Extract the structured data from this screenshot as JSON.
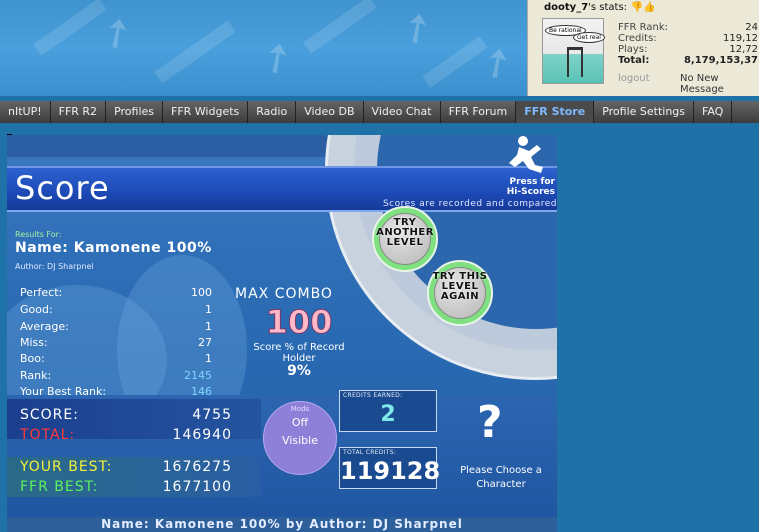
{
  "user_stats": {
    "username": "dooty_7",
    "suffix": "'s stats:",
    "speech_bubble_1": "Be rational",
    "speech_bubble_2": "Get real",
    "rows": [
      {
        "label": "FFR Rank:",
        "value": "24"
      },
      {
        "label": "Credits:",
        "value": "119,12"
      },
      {
        "label": "Plays:",
        "value": "12,72"
      },
      {
        "label": "Total:",
        "value": "8,179,153,37"
      }
    ],
    "logout": "logout",
    "messages": "No New Message"
  },
  "nav": {
    "tabs": [
      {
        "label": "nItUP!",
        "active": false
      },
      {
        "label": "FFR R2",
        "active": false
      },
      {
        "label": "Profiles",
        "active": false
      },
      {
        "label": "FFR Widgets",
        "active": false
      },
      {
        "label": "Radio",
        "active": false
      },
      {
        "label": "Video DB",
        "active": false
      },
      {
        "label": "Video Chat",
        "active": false
      },
      {
        "label": "FFR Forum",
        "active": false
      },
      {
        "label": "FFR Store",
        "active": true
      },
      {
        "label": "Profile Settings",
        "active": false
      },
      {
        "label": "FAQ",
        "active": false
      }
    ]
  },
  "game": {
    "title": "Score",
    "press_for": "Press for",
    "hi_scores": "Hi-Scores",
    "recorded_note": "Scores are recorded and compared",
    "try_another": [
      "TRY",
      "ANOTHER",
      "LEVEL"
    ],
    "try_again": [
      "TRY THIS",
      "LEVEL",
      "AGAIN"
    ],
    "results_for": "Results For:",
    "song_name": "Name: Kamonene 100%",
    "song_author": "Author: DJ Sharpnel",
    "stats": [
      {
        "label": "Perfect:",
        "value": "100"
      },
      {
        "label": "Good:",
        "value": "1"
      },
      {
        "label": "Average:",
        "value": "1"
      },
      {
        "label": "Miss:",
        "value": "27"
      },
      {
        "label": "Boo:",
        "value": "1"
      },
      {
        "label": "Rank:",
        "value": "2145"
      },
      {
        "label": "Your Best Rank:",
        "value": "146"
      }
    ],
    "max_combo_label": "MAX COMBO",
    "max_combo_value": "100",
    "pct_label": "Score % of Record Holder",
    "pct_value": "9%",
    "score_label": "SCORE:",
    "score_value": "4755",
    "total_label": "TOTAL:",
    "total_value": "146940",
    "your_best_label": "YOUR BEST:",
    "your_best_value": "1676275",
    "ffr_best_label": "FFR BEST:",
    "ffr_best_value": "1677100",
    "mods_label": "Mods",
    "mods_off": "Off",
    "mods_visible": "Visible",
    "credits_earned_label": "CREDITS EARNED:",
    "credits_earned_value": "2",
    "total_credits_label": "TOTAL CREDITS:",
    "total_credits_value": "119128",
    "question_mark": "?",
    "choose_character": "Please Choose a Character",
    "footer": "Name: Kamonene 100% by Author: DJ Sharpnel"
  },
  "colors": {
    "page_bg": "#1e72a8",
    "nav_active": "#7fb8ff",
    "score_label": "#ffffff",
    "total_label": "#ff3a3a",
    "your_best_label": "#f2f23a",
    "ffr_best_label": "#5cf05c",
    "rank_value": "#7fd4ff",
    "max_combo": "#ffb8c8",
    "credits_earned": "#7fe8e8",
    "button_ring": "#7ee07e"
  }
}
